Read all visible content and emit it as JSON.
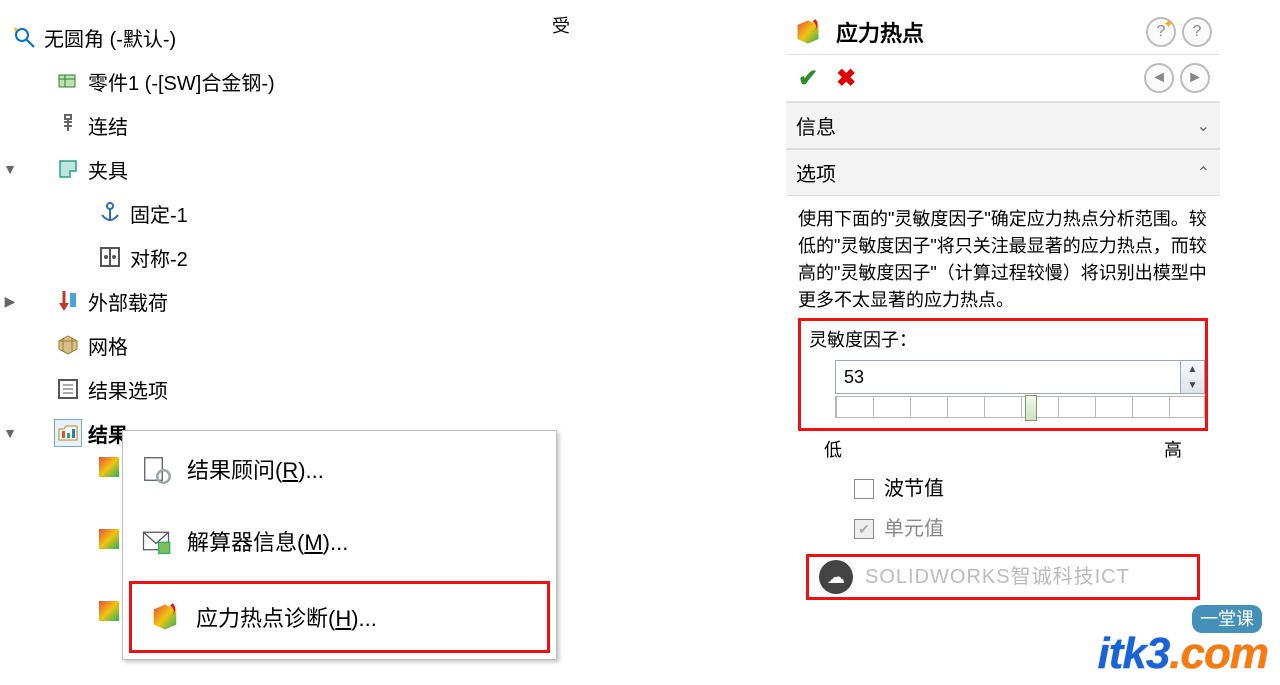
{
  "tree": {
    "root": "无圆角 (-默认-)",
    "part": "零件1 (-[SW]合金钢-)",
    "connections": "连结",
    "fixtures": "夹具",
    "fixture_fixed": "固定-1",
    "fixture_sym": "对称-2",
    "loads": "外部载荷",
    "mesh": "网格",
    "result_options": "结果选项",
    "results": "结果"
  },
  "context_menu": {
    "advisor_pre": "结果顾问(",
    "advisor_key": "R",
    "advisor_post": ")...",
    "solver_pre": "解算器信息(",
    "solver_key": "M",
    "solver_post": ")...",
    "hotspot_pre": "应力热点诊断(",
    "hotspot_key": "H",
    "hotspot_post": ")..."
  },
  "stray_char": "受",
  "pm": {
    "title": "应力热点",
    "sections": {
      "info": "信息",
      "options": "选项"
    },
    "options_desc": "使用下面的\"灵敏度因子\"确定应力热点分析范围。较低的\"灵敏度因子\"将只关注最显著的应力热点，而较高的\"灵敏度因子\"（计算过程较慢）将识别出模型中更多不太显著的应力热点。",
    "sensitivity_label": "灵敏度因子：",
    "sensitivity_value": "53",
    "low": "低",
    "high": "高",
    "nodal": "波节值",
    "elemental": "单元值",
    "watermark_text": "SOLIDWORKS智诚科技ICT"
  },
  "logo": {
    "main": "itk3",
    "suffix": ".com",
    "tag": "一堂课"
  }
}
